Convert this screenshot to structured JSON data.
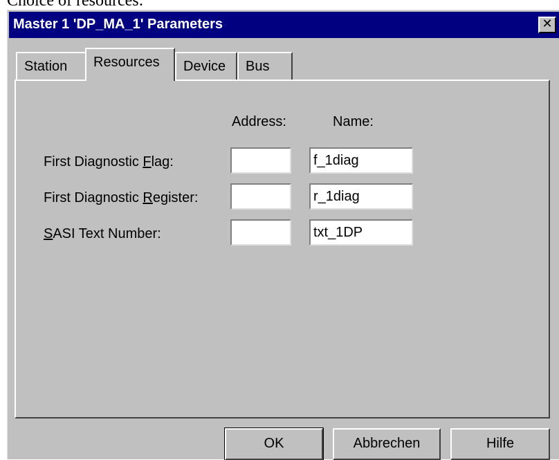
{
  "caption": "Choice of resources:",
  "window": {
    "title": "Master 1 'DP_MA_1' Parameters",
    "close_glyph": "✕"
  },
  "tabs": [
    {
      "label": "Station",
      "active": false
    },
    {
      "label": "Resources",
      "active": true
    },
    {
      "label": "Device",
      "active": false
    },
    {
      "label": "Bus",
      "active": false
    }
  ],
  "panel": {
    "address_header": "Address:",
    "name_header": "Name:",
    "rows": [
      {
        "label_pre": "First Diagnostic ",
        "label_ul": "F",
        "label_post": "lag:",
        "address": "",
        "name": "f_1diag"
      },
      {
        "label_pre": "First Diagnostic ",
        "label_ul": "R",
        "label_post": "egister:",
        "address": "",
        "name": "r_1diag"
      },
      {
        "label_pre": "",
        "label_ul": "S",
        "label_post": "ASI Text Number:",
        "address": "",
        "name": "txt_1DP"
      }
    ]
  },
  "buttons": {
    "ok": "OK",
    "cancel": "Abbrechen",
    "help": "Hilfe"
  }
}
